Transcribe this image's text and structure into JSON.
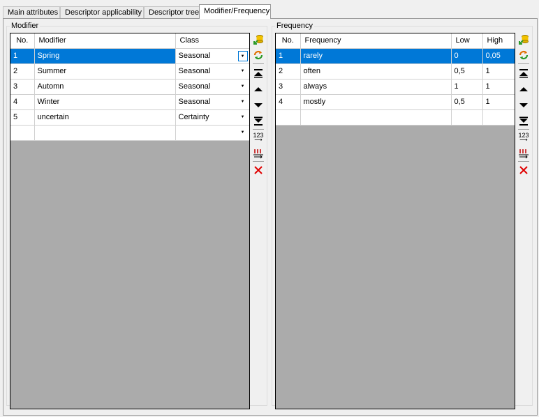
{
  "tabs": [
    {
      "label": "Main attributes",
      "active": false
    },
    {
      "label": "Descriptor applicability",
      "active": false
    },
    {
      "label": "Descriptor tree",
      "active": false
    },
    {
      "label": "Modifier/Frequency",
      "active": true
    }
  ],
  "modifier": {
    "title": "Modifier",
    "columns": [
      "No.",
      "Modifier",
      "Class"
    ],
    "rows": [
      {
        "no": "1",
        "modifier": "Spring",
        "class": "Seasonal",
        "selected": true
      },
      {
        "no": "2",
        "modifier": "Summer",
        "class": "Seasonal",
        "selected": false
      },
      {
        "no": "3",
        "modifier": "Automn",
        "class": "Seasonal",
        "selected": false
      },
      {
        "no": "4",
        "modifier": "Winter",
        "class": "Seasonal",
        "selected": false
      },
      {
        "no": "5",
        "modifier": "uncertain",
        "class": "Certainty",
        "selected": false
      },
      {
        "no": "",
        "modifier": "",
        "class": "",
        "selected": false
      }
    ]
  },
  "frequency": {
    "title": "Frequency",
    "columns": [
      "No.",
      "Frequency",
      "Low",
      "High"
    ],
    "rows": [
      {
        "no": "1",
        "frequency": "rarely",
        "low": "0",
        "high": "0,05",
        "selected": true
      },
      {
        "no": "2",
        "frequency": "often",
        "low": "0,5",
        "high": "1",
        "selected": false
      },
      {
        "no": "3",
        "frequency": "always",
        "low": "1",
        "high": "1",
        "selected": false
      },
      {
        "no": "4",
        "frequency": "mostly",
        "low": "0,5",
        "high": "1",
        "selected": false
      },
      {
        "no": "",
        "frequency": "",
        "low": "",
        "high": "",
        "selected": false
      }
    ]
  },
  "toolbar_icons": {
    "import": "database-import-icon",
    "refresh": "refresh-icon",
    "move_first": "move-first-icon",
    "move_up": "move-up-icon",
    "move_down": "move-down-icon",
    "move_last": "move-last-icon",
    "renumber": "123",
    "sort": "sort-icon",
    "delete": "delete-icon"
  },
  "colors": {
    "selection": "#0078d7",
    "grid_background": "#ababab",
    "delete": "#e00000"
  }
}
